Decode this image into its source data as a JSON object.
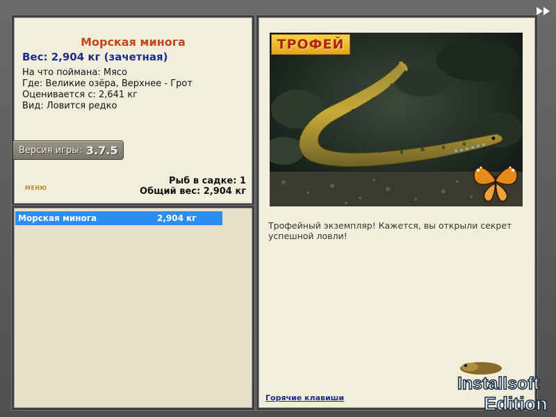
{
  "fish": {
    "title": "Морская минога",
    "weight_line": "Вес: 2,904 кг (зачетная)",
    "bait_line": "На что поймана: Мясо",
    "place_line": "Где: Великие озёра, Верхнее - Грот",
    "value_line": "Оценивается с: 2,641 кг",
    "kind_line": "Вид: Ловится редко"
  },
  "version": {
    "label": "Версия игры:",
    "number": "3.7.5"
  },
  "menu_hint": "МЕНЮ",
  "keepnet": {
    "count_line": "Рыб в садке: 1",
    "total_line": "Общий вес: 2,904 кг"
  },
  "catch_list": [
    {
      "name": "Морская минога",
      "weight": "2,904 кг"
    }
  ],
  "trophy_badge": "ТРОФЕЙ",
  "detail_text": "Трофейный экземпляр! Кажется, вы открыли секрет успешной ловли!",
  "hotkeys_link": "Горячие клавиши",
  "edition_logo": {
    "line1": "Installsoft",
    "line2": "Edition"
  },
  "colors": {
    "title": "#c0461a",
    "weight": "#1e2b8a",
    "highlight": "#2b8ef0",
    "panel": "#f2eedc",
    "frame": "#5e5e5e"
  },
  "icons": {
    "forward": "double-arrow-right-icon",
    "butterfly": "butterfly-icon",
    "fish": "fish-icon"
  }
}
